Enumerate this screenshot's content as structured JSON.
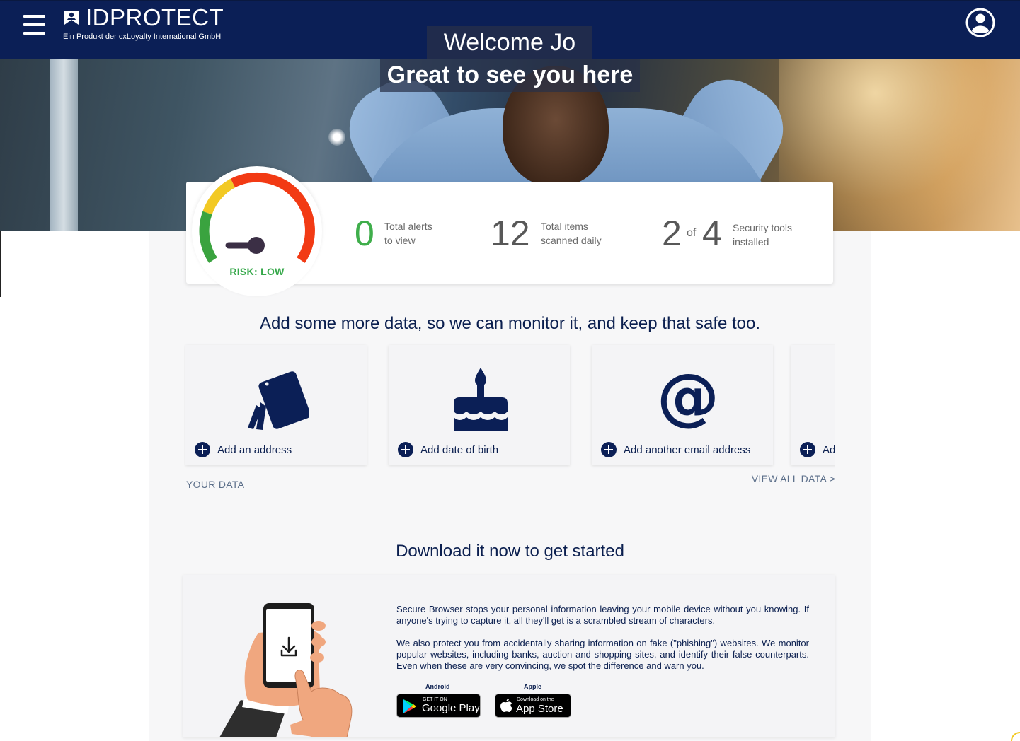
{
  "header": {
    "brand": "IDPROTECT",
    "subtitle": "Ein Produkt der cxLoyalty International GmbH"
  },
  "hero": {
    "welcome": "Welcome Jo",
    "tagline": "Great to see you here"
  },
  "risk": {
    "label": "RISK: LOW",
    "level": "low"
  },
  "stats": {
    "alerts": {
      "value": "0",
      "label_line1": "Total alerts",
      "label_line2": "to view"
    },
    "scanned": {
      "value": "12",
      "label_line1": "Total items",
      "label_line2": "scanned daily"
    },
    "tools": {
      "installed": "2",
      "of": "of",
      "total": "4",
      "label_line1": "Security tools",
      "label_line2": "installed"
    }
  },
  "add_data": {
    "title": "Add some more data, so we can monitor it, and keep that safe too.",
    "tiles": [
      {
        "label": "Add an address",
        "icon": "address-cards-icon"
      },
      {
        "label": "Add date of birth",
        "icon": "birthday-cake-icon"
      },
      {
        "label": "Add another email address",
        "icon": "at-sign-icon"
      },
      {
        "label": "Ad",
        "icon": ""
      }
    ],
    "your_data": "YOUR DATA",
    "view_all": "VIEW ALL DATA >"
  },
  "download": {
    "title": "Download it now to get started",
    "para1": "Secure Browser stops your personal information leaving your mobile device without you knowing. If anyone's trying to capture it, all they'll get is a scrambled stream of characters.",
    "para2": "We also protect you from accidentally sharing information on fake (\"phishing\") websites. We monitor popular websites, including banks, auction and shopping sites, and identify their false counterparts. Even when these are very convincing, we spot the difference and warn you.",
    "android_caption": "Android",
    "apple_caption": "Apple",
    "google_small": "GET IT ON",
    "google_big": "Google Play",
    "apple_small": "Download on the",
    "apple_big": "App Store"
  },
  "colors": {
    "navy": "#0b1f56",
    "green": "#3fae4b",
    "risk_green": "#36a84a"
  }
}
